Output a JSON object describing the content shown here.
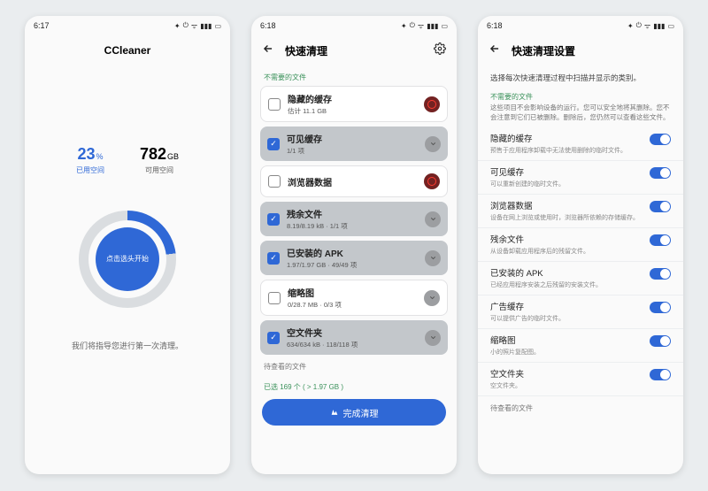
{
  "screens": {
    "s1": {
      "time": "6:17",
      "app_title": "CCleaner",
      "used_pct": "23",
      "used_pct_unit": "%",
      "used_label": "已用空间",
      "free_val": "782",
      "free_unit": "GB",
      "free_label": "可用空间",
      "button": "点击选头开始",
      "tip": "我们将指导您进行第一次清理。"
    },
    "s2": {
      "time": "6:18",
      "app_title": "快速清理",
      "section_unneeded": "不需要的文件",
      "items": [
        {
          "checked": false,
          "title": "隐藏的缓存",
          "sub": "估计 11.1 GB",
          "badge": "red"
        },
        {
          "checked": true,
          "title": "可见缓存",
          "sub": "1/1 项",
          "badge": "grey"
        },
        {
          "checked": false,
          "title": "浏览器数据",
          "sub": "",
          "badge": "red"
        },
        {
          "checked": true,
          "title": "残余文件",
          "sub": "8.19/8.19 kB · 1/1 项",
          "badge": "grey"
        },
        {
          "checked": true,
          "title": "已安装的 APK",
          "sub": "1.97/1.97 GB · 49/49 项",
          "badge": "grey"
        },
        {
          "checked": false,
          "title": "缩略图",
          "sub": "0/28.7 MB · 0/3 项",
          "badge": "grey"
        },
        {
          "checked": true,
          "title": "空文件夹",
          "sub": "634/634 kB · 118/118 项",
          "badge": "grey"
        }
      ],
      "section_review": "待查看的文件",
      "scan_summary": "已选 169 个 ( > 1.97 GB )",
      "done": "完成清理"
    },
    "s3": {
      "time": "6:18",
      "app_title": "快速清理设置",
      "intro": "选择每次快速清理过程中扫描并显示的类别。",
      "subheading": "不需要的文件",
      "desc": "这些项目不会影响设备的运行。您可以安全地将其删除。您不会注意到它们已被删除。删除后，您仍然可以查看这些文件。",
      "rows": [
        {
          "title": "隐藏的缓存",
          "sub": "预售于应用程序卸载中无法使用删除的临时文件。"
        },
        {
          "title": "可见缓存",
          "sub": "可以重新创建的临时文件。"
        },
        {
          "title": "浏览器数据",
          "sub": "设备在网上浏览或使用时，浏览器所依赖的存储缓存。"
        },
        {
          "title": "残余文件",
          "sub": "从设备卸载应用程序后的残留文件。"
        },
        {
          "title": "已安装的 APK",
          "sub": "已经应用程序安装之后残留的安装文件。"
        },
        {
          "title": "广告缓存",
          "sub": "可以提供广告的临时文件。"
        },
        {
          "title": "缩略图",
          "sub": "小的照片复配图。"
        },
        {
          "title": "空文件夹",
          "sub": "空文件夹。"
        }
      ],
      "section_review": "待查看的文件"
    }
  }
}
